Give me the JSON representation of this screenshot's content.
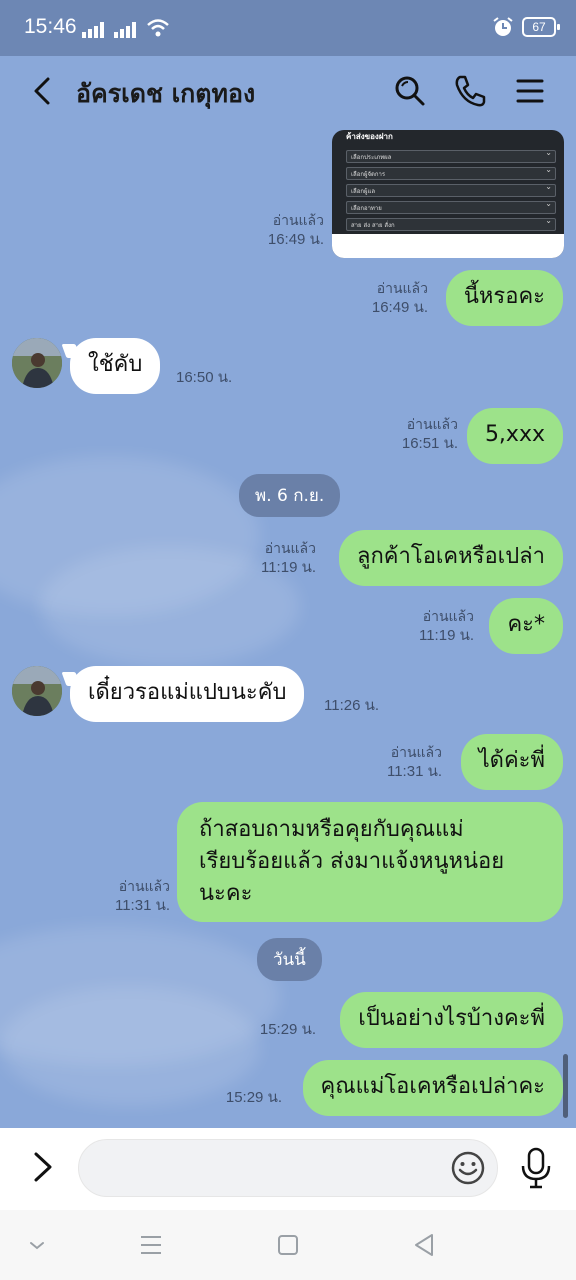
{
  "status": {
    "time": "15:46",
    "battery": "67"
  },
  "header": {
    "contact_name": "อัครเดช เกตุทอง"
  },
  "image_message": {
    "read": "อ่านแล้ว",
    "time": "16:49 น.",
    "title": "ค้าส่งของฝาก",
    "rows": [
      "เลือกประเภทผล",
      "เลือกผู้จัดการ",
      "เลือกผู้แล",
      "เลือกอาทาย",
      "สาย ส่ง สาย สั่งก"
    ]
  },
  "messages": [
    {
      "dir": "out",
      "text": "นี้หรอคะ",
      "read": "อ่านแล้ว",
      "time": "16:49 น."
    },
    {
      "dir": "in",
      "text": "ใช้คับ",
      "time": "16:50 น."
    },
    {
      "dir": "out",
      "text": "5,xxx",
      "read": "อ่านแล้ว",
      "time": "16:51 น."
    },
    {
      "dir": "date",
      "text": "พ. 6 ก.ย."
    },
    {
      "dir": "out",
      "text": "ลูกค้าโอเคหรือเปล่า",
      "read": "อ่านแล้ว",
      "time": "11:19 น."
    },
    {
      "dir": "out",
      "text": "คะ*",
      "read": "อ่านแล้ว",
      "time": "11:19 น."
    },
    {
      "dir": "in",
      "text": "เดี๋ยวรอแม่แปบนะคับ",
      "time": "11:26 น."
    },
    {
      "dir": "out",
      "text": "ได้ค่ะพี่",
      "read": "อ่านแล้ว",
      "time": "11:31 น."
    },
    {
      "dir": "out",
      "lines": [
        "ถ้าสอบถามหรือคุยกับคุณแม่",
        "เรียบร้อยแล้ว ส่งมาแจ้งหนูหน่อย",
        "นะคะ"
      ],
      "read": "อ่านแล้ว",
      "time": "11:31 น."
    },
    {
      "dir": "date",
      "text": "วันนี้"
    },
    {
      "dir": "out",
      "text": "เป็นอย่างไรบ้างคะพี่",
      "time": "15:29 น."
    },
    {
      "dir": "out",
      "text": "คุณแม่โอเคหรือเปล่าคะ",
      "time": "15:29 น."
    }
  ],
  "input": {
    "placeholder": ""
  },
  "colors": {
    "background": "#8aa8d9",
    "status_bar": "#6d87b4",
    "out_bubble": "#9de28a",
    "in_bubble": "#ffffff",
    "date_pill": "#6a80a8"
  },
  "icons": [
    "wifi-icon",
    "signal-icon",
    "alarm-icon",
    "battery-icon",
    "back-arrow-icon",
    "search-icon",
    "phone-icon",
    "menu-icon",
    "chevron-right-icon",
    "emoji-icon",
    "microphone-icon",
    "nav-down-icon",
    "nav-menu-icon",
    "nav-home-icon",
    "nav-back-icon"
  ]
}
